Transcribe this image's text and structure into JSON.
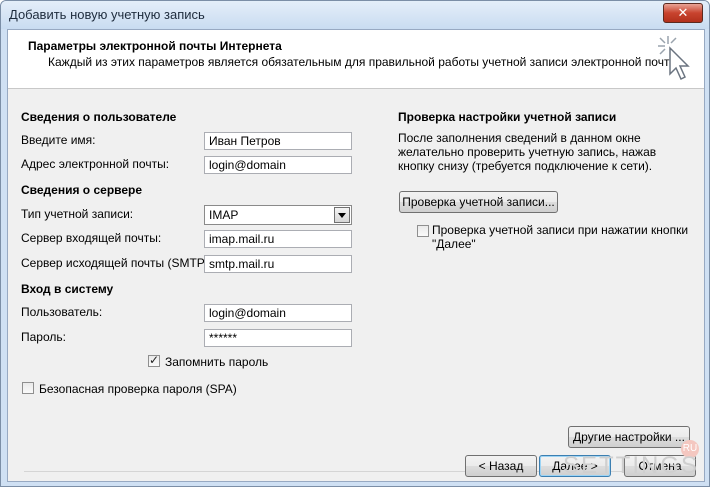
{
  "window": {
    "title": "Добавить новую учетную запись",
    "close_label": "✕"
  },
  "header": {
    "title": "Параметры электронной почты Интернета",
    "subtitle": "Каждый из этих параметров является обязательным для правильной работы учетной записи электронной почты."
  },
  "user_info": {
    "section_title": "Сведения о пользователе",
    "name_label": "Введите имя:",
    "name_value": "Иван Петров",
    "email_label": "Адрес электронной почты:",
    "email_value": "login@domain"
  },
  "server_info": {
    "section_title": "Сведения о сервере",
    "account_type_label": "Тип учетной записи:",
    "account_type_value": "IMAP",
    "incoming_label": "Сервер входящей почты:",
    "incoming_value": "imap.mail.ru",
    "outgoing_label": "Сервер исходящей почты (SMTP):",
    "outgoing_value": "smtp.mail.ru"
  },
  "logon": {
    "section_title": "Вход в систему",
    "user_label": "Пользователь:",
    "user_value": "login@domain",
    "password_label": "Пароль:",
    "password_value": "******",
    "remember_label": "Запомнить пароль",
    "remember_checked": true,
    "spa_label": "Безопасная проверка пароля (SPA)",
    "spa_checked": false
  },
  "test": {
    "section_title": "Проверка настройки учетной записи",
    "description": "После заполнения сведений в данном окне желательно проверить учетную запись, нажав кнопку снизу (требуется подключение к сети).",
    "test_button": "Проверка учетной записи...",
    "auto_test_label": "Проверка учетной записи при нажатии кнопки \"Далее\"",
    "auto_test_checked": false
  },
  "buttons": {
    "more_settings": "Другие настройки ...",
    "back": "< Назад",
    "next": "Далее >",
    "cancel": "Отмена"
  },
  "watermark": {
    "text": "SETTINGS",
    "badge": "RU"
  },
  "colors": {
    "title_bg": "#cfe0f3",
    "client_bg": "#f0f0f0",
    "close_red": "#c8432e"
  }
}
